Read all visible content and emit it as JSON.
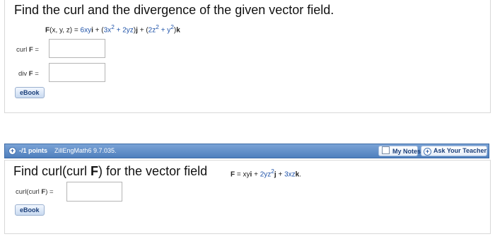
{
  "q1": {
    "prompt": "Find the curl and the divergence of the given vector field.",
    "formula": {
      "lhs": "F",
      "args": "(x, y, z) = ",
      "t1": "6xy",
      "i": "i",
      "plus1": " + (",
      "t2": "3x",
      "t2sup": "2",
      "t2b": " + 2yz",
      "close1": ")",
      "j": "j",
      "plus2": " + (",
      "t3": "2z",
      "t3sup": "2",
      "t3b": " + y",
      "t3bsup": "2",
      "close2": ")",
      "k": "k"
    },
    "curl_label": "curl",
    "curl_F": "F",
    "curl_eq": "=",
    "curl_value": "",
    "div_label": "div",
    "div_F": "F",
    "div_eq": "=",
    "div_value": "",
    "ebook": "eBook"
  },
  "q2": {
    "bar": {
      "points": "-/1 points",
      "source": "ZillEngMath6 9.7.035.",
      "my_notes": "My Notes",
      "ask_teacher": "Ask Your Teacher"
    },
    "prompt_a": "Find curl(curl ",
    "prompt_F": "F",
    "prompt_b": ") for the vector field",
    "formula": {
      "lhs": "F",
      "eq": " = ",
      "t1": "xy",
      "i": "i",
      "plus1": " + ",
      "t2": "2yz",
      "t2sup": "2",
      "j": "j",
      "plus2": " + ",
      "t3": "3xz",
      "k": "k",
      "end": "."
    },
    "answer_label": "curl(curl",
    "answer_F": "F",
    "answer_close": ") =",
    "answer_value": "",
    "ebook": "eBook"
  }
}
